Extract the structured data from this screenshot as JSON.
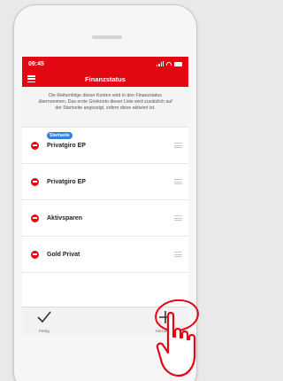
{
  "status_bar": {
    "time": "09:45"
  },
  "nav": {
    "title": "Finanzstatus"
  },
  "info_text": "Die Reihenfolge dieser Konten wird in den Finanzstatus übernommen. Das erste Girokonto dieser Liste wird zusätzlich auf der Startseite angezeigt, sofern diese aktiviert ist.",
  "accounts": [
    {
      "label": "Privatgiro EP",
      "badge": "Startseite"
    },
    {
      "label": "Privatgiro EP"
    },
    {
      "label": "Aktivsparen"
    },
    {
      "label": "Gold Privat"
    }
  ],
  "tabbar": {
    "done_label": "Fertig",
    "add_label": "Hinzufügen"
  },
  "colors": {
    "accent": "#e30613",
    "badge": "#2f7fe0"
  }
}
